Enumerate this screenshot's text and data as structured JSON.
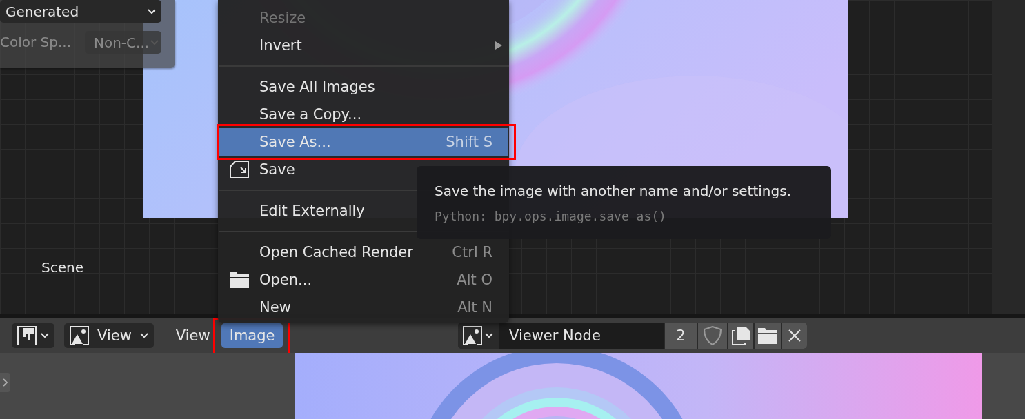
{
  "node_editor": {
    "scene_label": "Scene",
    "panel": {
      "source": {
        "value": "Generated"
      },
      "color_space": {
        "label": "Color Sp...",
        "value": "Non-C...",
        "disabled": true
      }
    }
  },
  "menu": {
    "items": [
      {
        "kind": "item",
        "label": "Resize",
        "disabled": true,
        "selected": false
      },
      {
        "kind": "submenu",
        "label": "Invert",
        "disabled": false,
        "selected": false
      },
      {
        "kind": "separator"
      },
      {
        "kind": "item",
        "label": "Save All Images",
        "disabled": false,
        "selected": false
      },
      {
        "kind": "item",
        "label": "Save a Copy...",
        "disabled": false,
        "selected": false
      },
      {
        "kind": "item",
        "label": "Save As...",
        "shortcut": "Shift S",
        "disabled": false,
        "selected": true,
        "highlighted": true
      },
      {
        "kind": "save",
        "label": "Save",
        "disabled": false,
        "selected": false
      },
      {
        "kind": "separator"
      },
      {
        "kind": "item",
        "label": "Edit Externally",
        "disabled": false,
        "selected": false
      },
      {
        "kind": "separator"
      },
      {
        "kind": "item",
        "label": "Open Cached Render",
        "shortcut": "Ctrl R",
        "disabled": false,
        "selected": false
      },
      {
        "kind": "open",
        "label": "Open...",
        "shortcut": "Alt O",
        "disabled": false,
        "selected": false
      },
      {
        "kind": "item",
        "label": "New",
        "shortcut": "Alt N",
        "disabled": false,
        "selected": false
      }
    ]
  },
  "tooltip": {
    "description": "Save the image with another name and/or settings.",
    "python": "Python: bpy.ops.image.save_as()"
  },
  "image_editor": {
    "header": {
      "view_mode": "View",
      "menus": [
        {
          "label": "View",
          "selected": false,
          "highlighted": false
        },
        {
          "label": "Image",
          "selected": true,
          "highlighted": true
        }
      ],
      "image_name": "Viewer Node",
      "user_count": "2"
    }
  }
}
